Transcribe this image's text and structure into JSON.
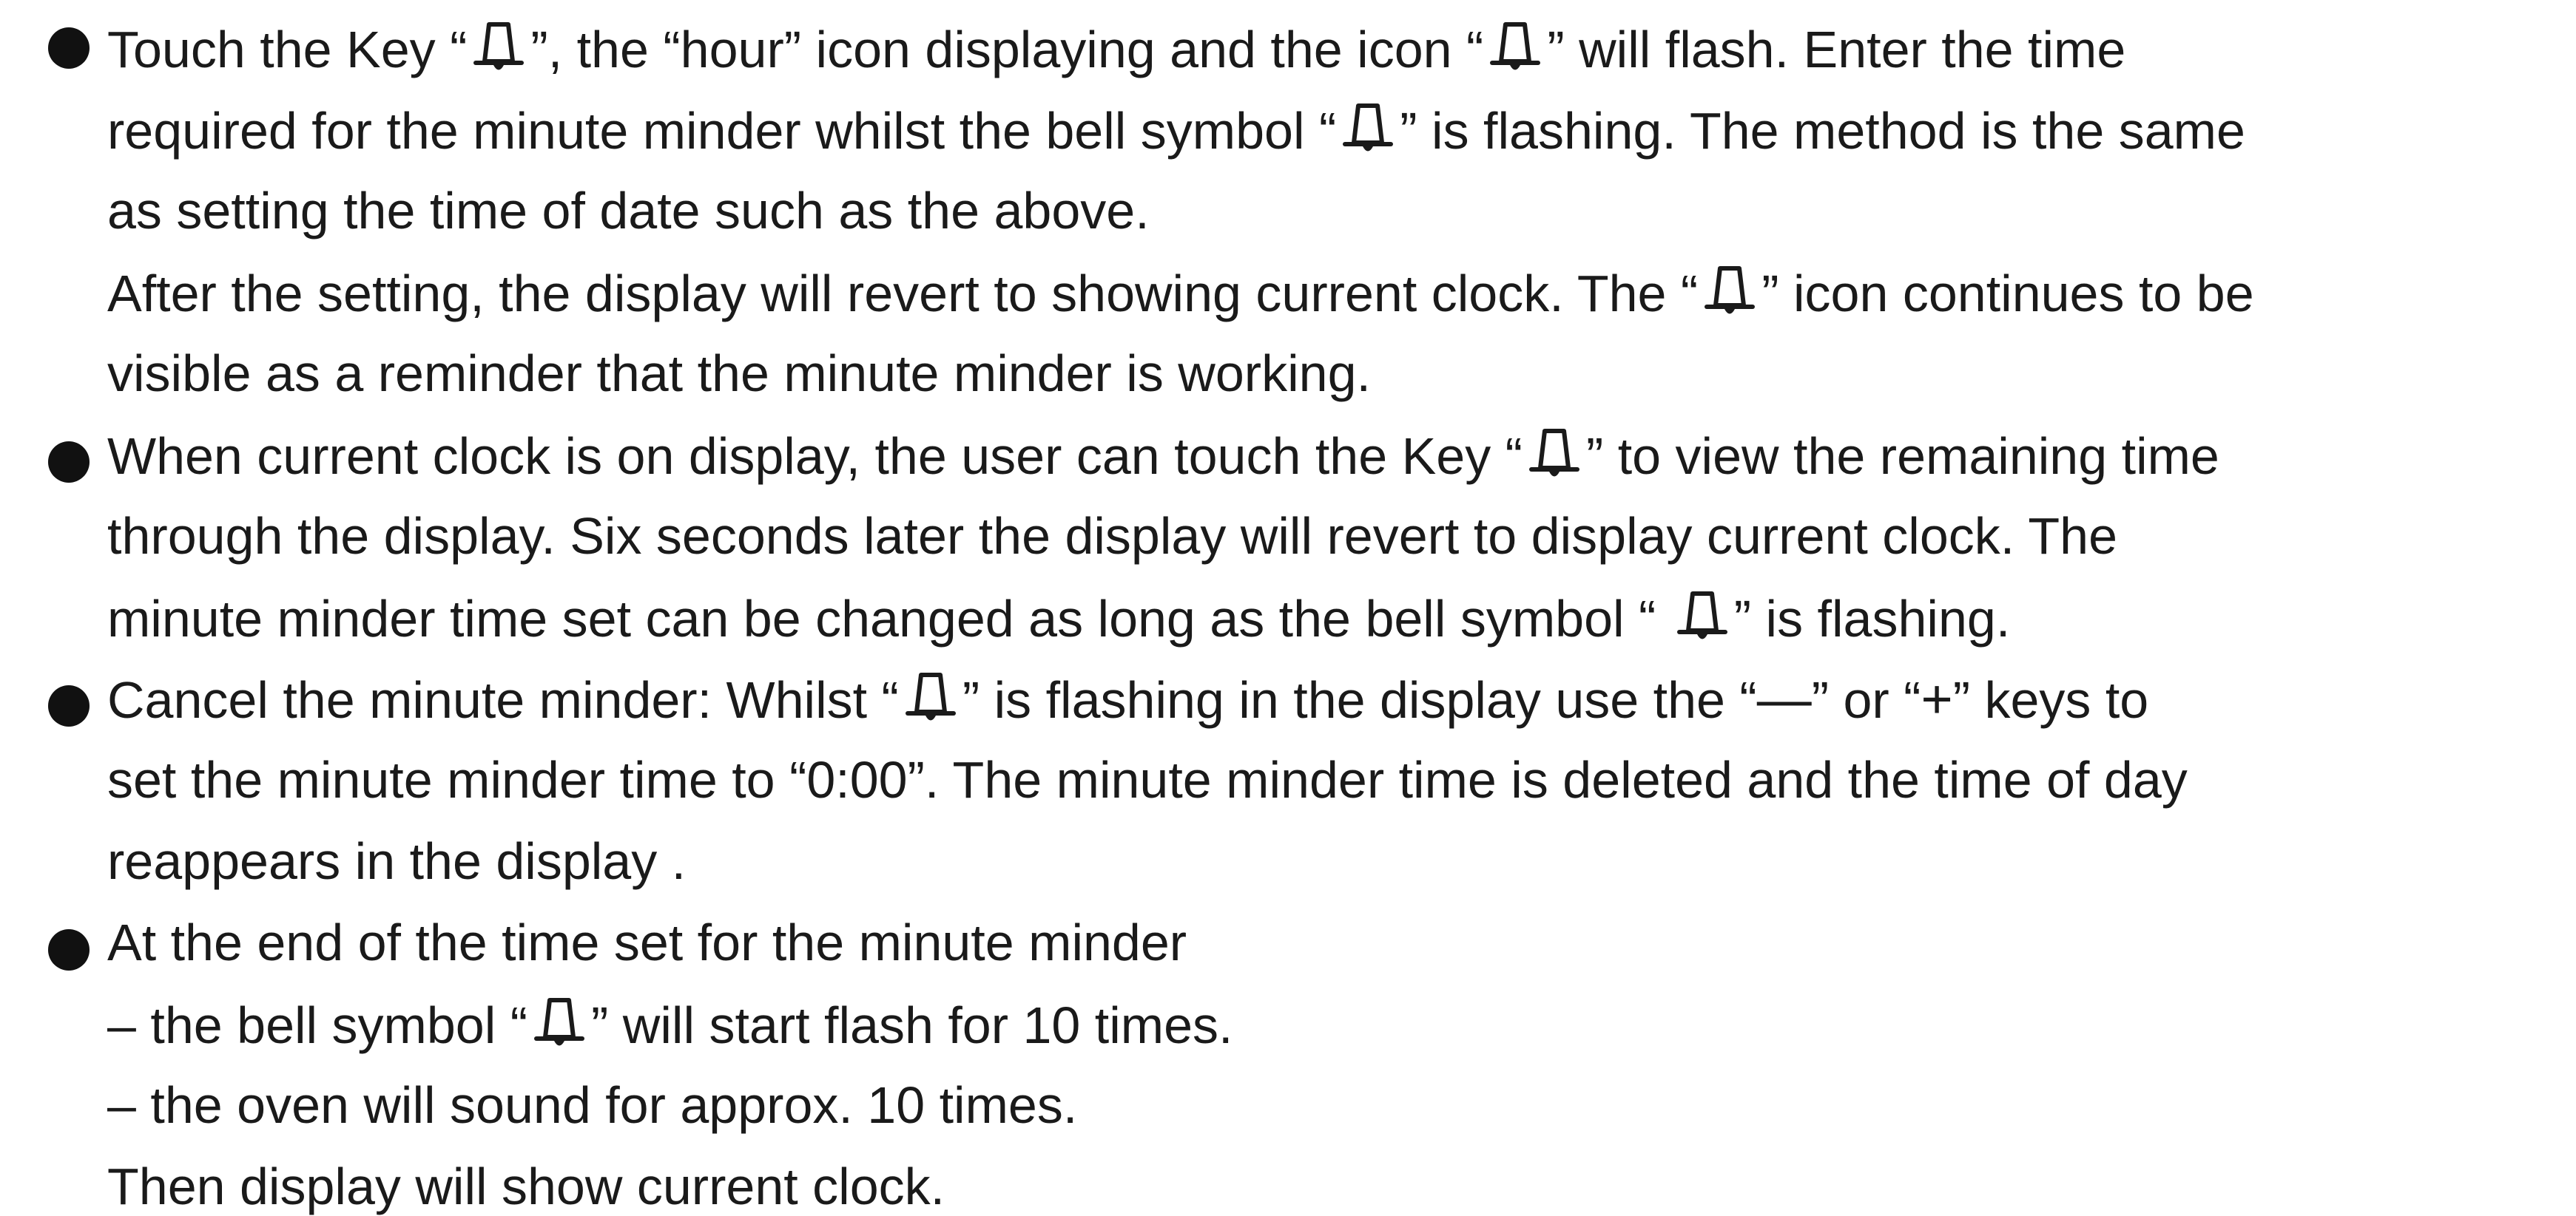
{
  "bullets": [
    {
      "lines": [
        [
          "Touch the Key “",
          "”, the “hour” icon displaying and the icon “",
          "” will flash. Enter the time"
        ],
        [
          "required for the minute minder whilst the bell symbol “",
          "” is flashing. The method is the same"
        ],
        [
          "as setting the time of date such as the above."
        ],
        [
          "After the setting, the display will revert to showing current clock. The “",
          "” icon continues to be"
        ],
        [
          "visible as a reminder that the minute minder is working."
        ]
      ]
    },
    {
      "lines": [
        [
          "When current clock is on display, the user can touch the Key “",
          "” to view the remaining time"
        ],
        [
          "through the display. Six seconds later the display will revert to display current clock. The"
        ],
        [
          "minute minder time set can be changed as long as the bell symbol “ ",
          "” is flashing."
        ]
      ]
    },
    {
      "lines": [
        [
          "Cancel the minute minder: Whilst “",
          "” is flashing in the display use the “",
          "” or “",
          "” keys to"
        ],
        [
          "set the minute minder time to “0:00”. The minute minder time is deleted and the time of day"
        ],
        [
          "reappears in the display ."
        ]
      ]
    },
    {
      "lines": [
        [
          "At the end of the time set for the minute minder"
        ],
        [
          "– the bell symbol “",
          "” will start flash for 10 times."
        ],
        [
          "– the oven will sound for approx. 10 times."
        ],
        [
          "Then display will show current clock."
        ]
      ]
    }
  ],
  "symbols": {
    "minus": "—",
    "plus": "+"
  },
  "icons": {
    "bell": "bell-icon",
    "bullet": "bullet-dot"
  },
  "colors": {
    "text": "#1a1a1a",
    "background": "#ffffff"
  }
}
